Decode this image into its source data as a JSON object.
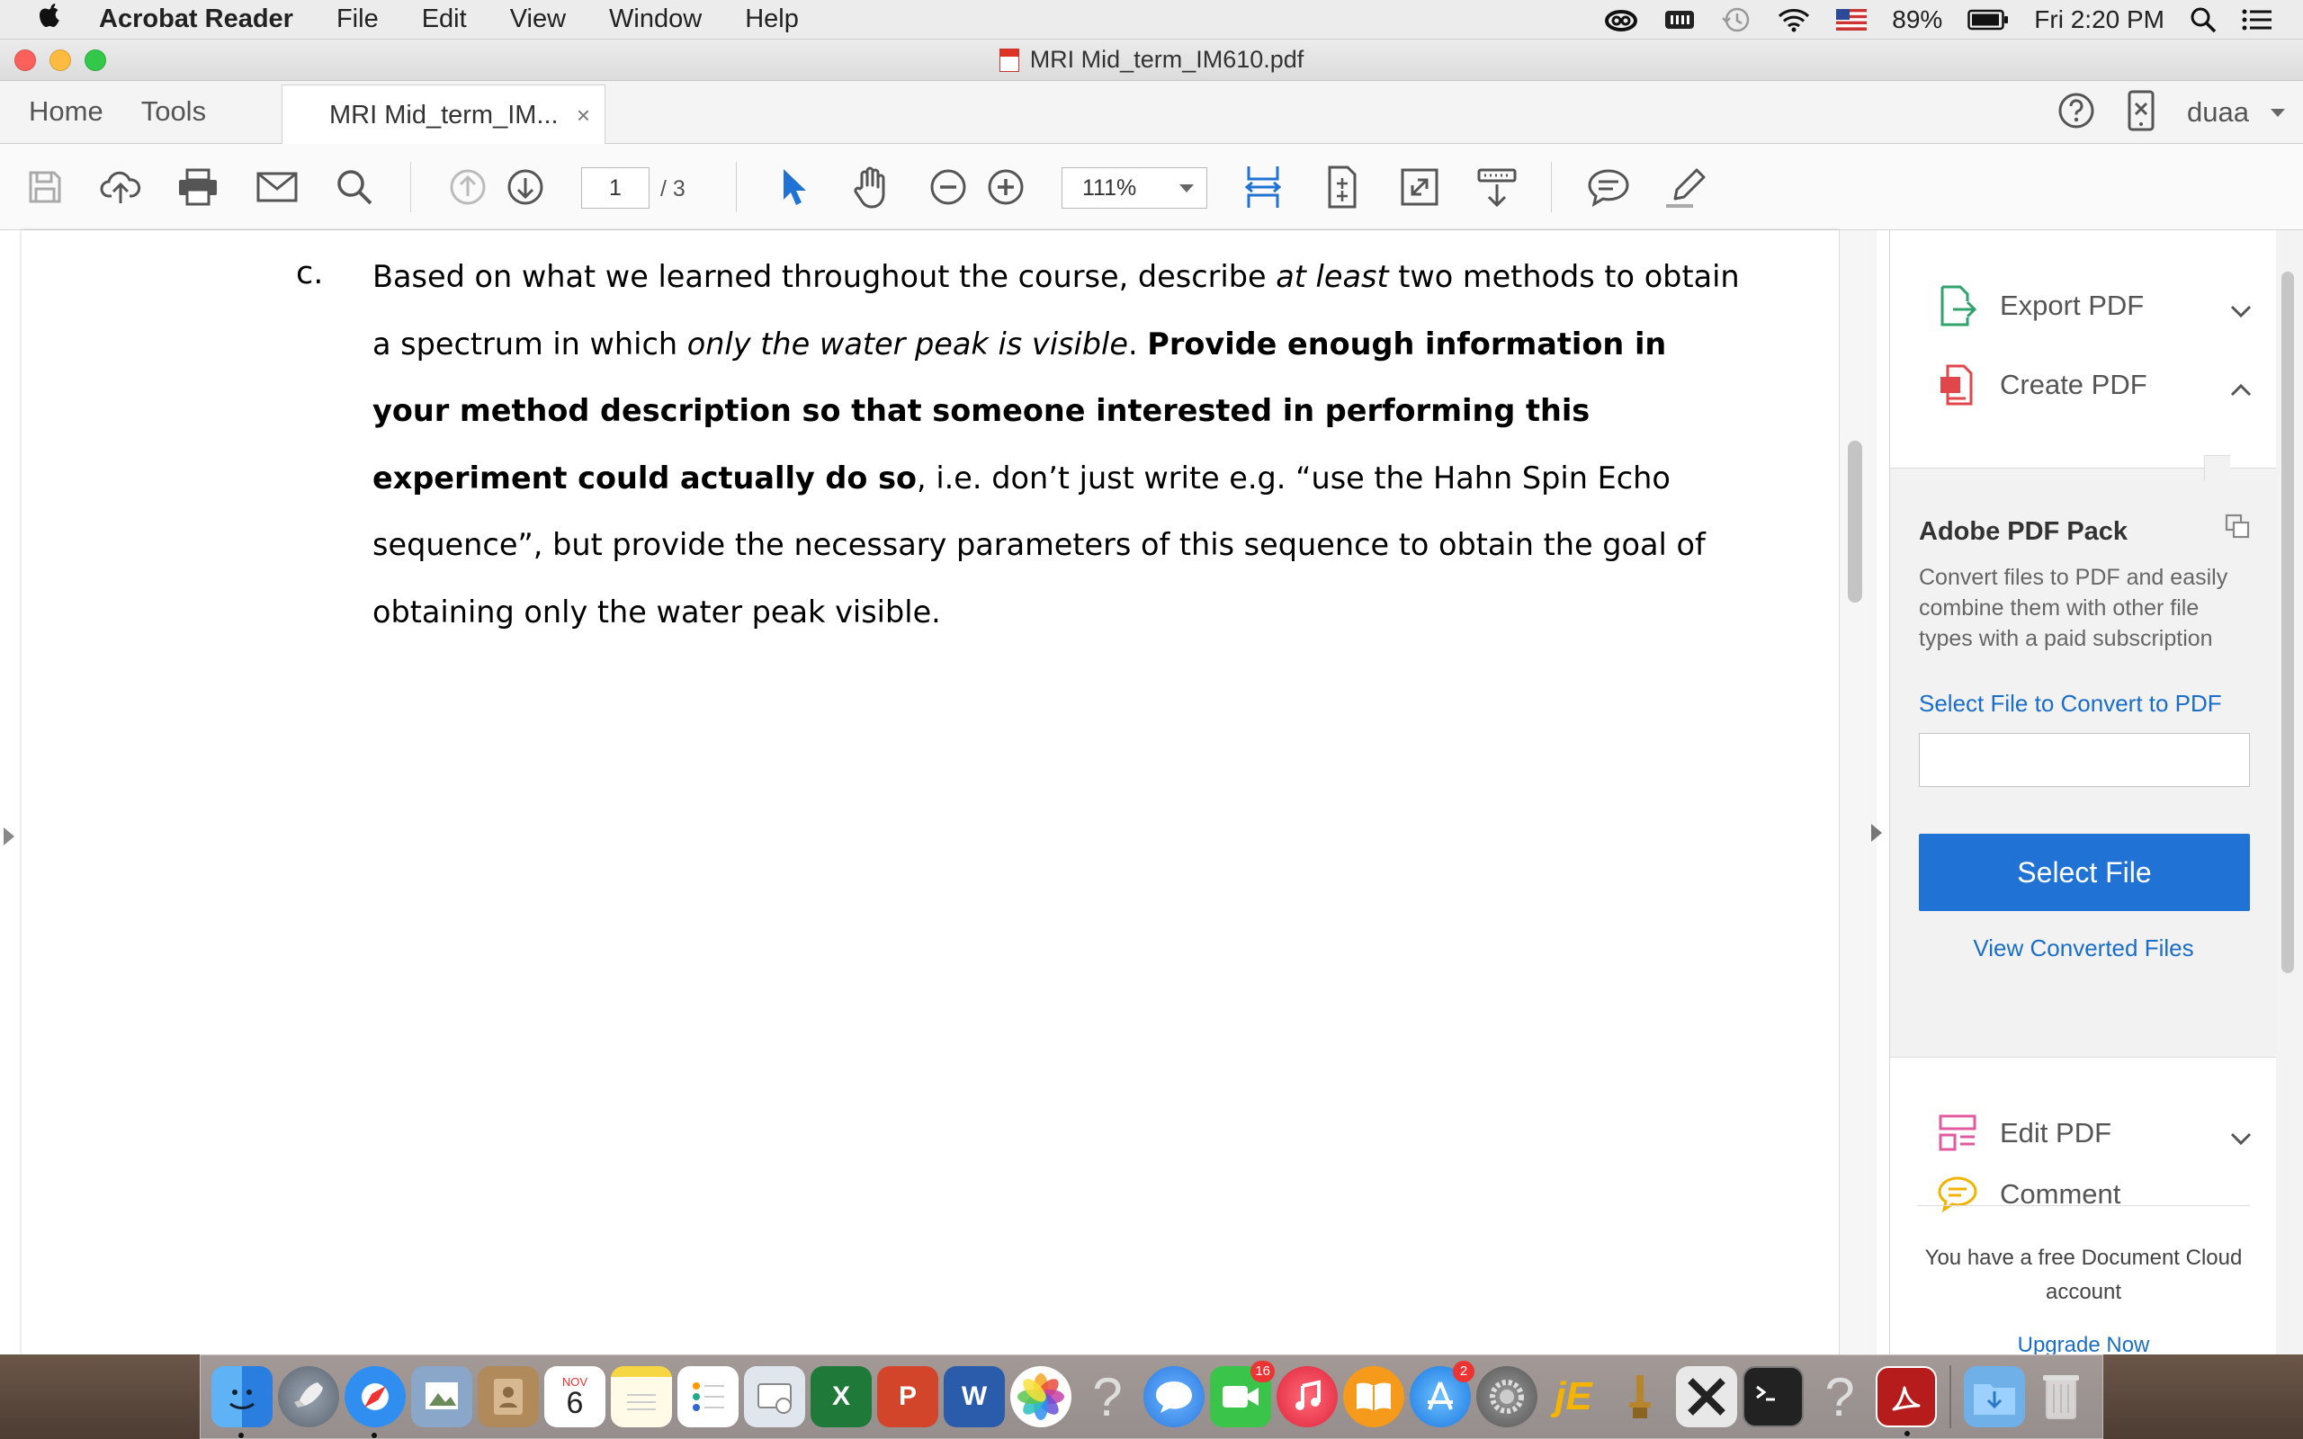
{
  "menubar": {
    "app_name": "Acrobat Reader",
    "menus": [
      "File",
      "Edit",
      "View",
      "Window",
      "Help"
    ],
    "battery": "89%",
    "clock": "Fri 2:20 PM"
  },
  "window": {
    "title": "MRI Mid_term_IM610.pdf"
  },
  "tabs": {
    "home": "Home",
    "tools": "Tools",
    "document": "MRI Mid_term_IM...",
    "close": "×",
    "user": "duaa"
  },
  "toolbar": {
    "page_current": "1",
    "page_total": "/ 3",
    "zoom": "111%"
  },
  "document": {
    "marker": "c.",
    "seg1": "Based on what we learned throughout the course, describe ",
    "seg2_italic": "at least",
    "seg3": " two methods to obtain a spectrum in which ",
    "seg4_italic": "only the water peak is visible",
    "seg5": ". ",
    "seg6_bold": "Provide enough information in your method description so that someone interested in performing this experiment could actually do so",
    "seg7": ", i.e. don’t just write e.g. “use the Hahn Spin Echo sequence”, but provide the necessary parameters of this sequence to obtain the goal of obtaining only the water peak visible."
  },
  "right_pane": {
    "export_pdf": "Export PDF",
    "create_pdf": "Create PDF",
    "pack_title": "Adobe PDF Pack",
    "pack_desc": "Convert files to PDF and easily combine them with other file types with a paid subscription",
    "select_link": "Select File to Convert to PDF",
    "select_button": "Select File",
    "view_converted": "View Converted Files",
    "edit_pdf": "Edit PDF",
    "comment": "Comment",
    "footer": "You have a free Document Cloud account",
    "upgrade": "Upgrade Now"
  },
  "dock": {
    "calendar_month": "NOV",
    "calendar_day": "6",
    "facetime_badge": "16",
    "appstore_badge": "2"
  },
  "colors": {
    "accent_blue": "#2073d4",
    "link_blue": "#1a6ec8"
  }
}
